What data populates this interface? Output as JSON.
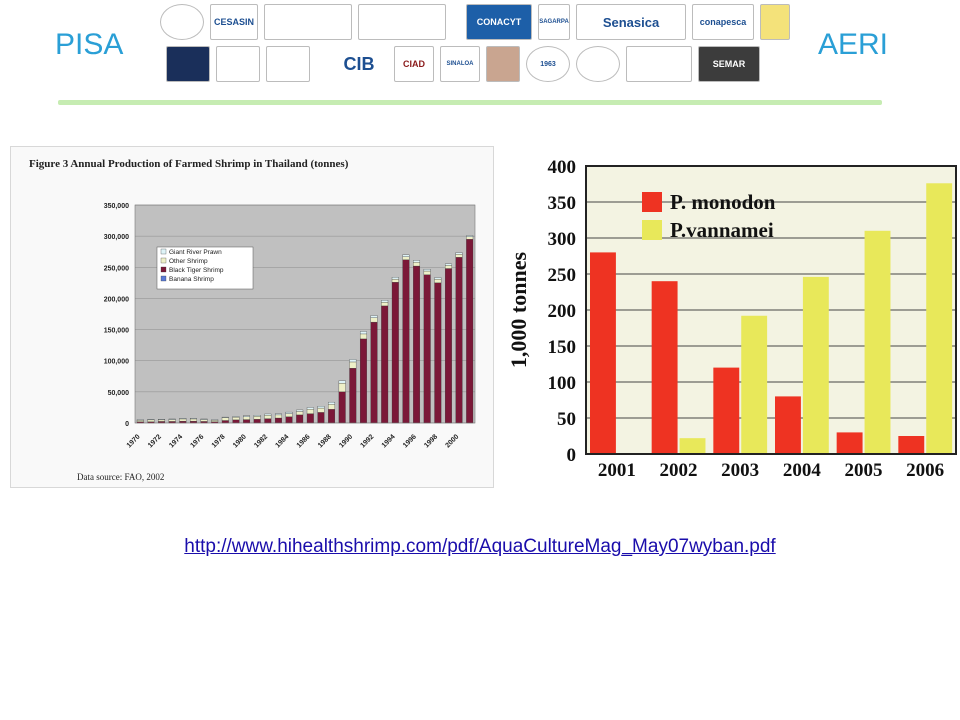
{
  "header": {
    "left_text": "PISA",
    "right_text": "AERI",
    "logos_top": [
      {
        "label": "",
        "icon": "bird-emblem-icon"
      },
      {
        "label": "CESASIN",
        "icon": "fish-emblem-icon"
      },
      {
        "label": "",
        "icon": "wave-emblem-icon"
      },
      {
        "label": "",
        "icon": "crest-emblem-icon"
      },
      {
        "label": "CONACYT",
        "icon": "conacyt-logo-icon"
      },
      {
        "label": "SAGARPA",
        "icon": "eagle-seal-icon"
      },
      {
        "label": "Senasica",
        "icon": "senasica-logo-icon"
      },
      {
        "label": "conapesca",
        "icon": "conapesca-logo-icon"
      },
      {
        "label": "",
        "icon": "state-crest-icon"
      }
    ],
    "logos_bottom": [
      {
        "label": "",
        "icon": "university-seal-icon"
      },
      {
        "label": "",
        "icon": "state-shield-icon"
      },
      {
        "label": "",
        "icon": "coat-of-arms-icon"
      },
      {
        "label": "CIB",
        "icon": "cib-logo-icon"
      },
      {
        "label": "CIAD",
        "icon": "ciad-logo-icon"
      },
      {
        "label": "SINALOA",
        "icon": "sinaloa-logo-icon"
      },
      {
        "label": "",
        "icon": "aztec-emblem-icon"
      },
      {
        "label": "1963",
        "icon": "round-seal-icon"
      },
      {
        "label": "",
        "icon": "round-crest-icon"
      },
      {
        "label": "",
        "icon": "shrimp-emblem-icon"
      },
      {
        "label": "SEMAR",
        "icon": "semar-logo-icon"
      }
    ]
  },
  "link": {
    "url": "http://www.hihealthshrimp.com/pdf/AquaCultureMag_May07wyban.pdf"
  },
  "chart_data": [
    {
      "type": "bar",
      "stacked": true,
      "title": "Figure 3   Annual Production of Farmed Shrimp in Thailand (tonnes)",
      "source": "Data source: FAO, 2002",
      "x": [
        1970,
        1971,
        1972,
        1973,
        1974,
        1975,
        1976,
        1977,
        1978,
        1979,
        1980,
        1981,
        1982,
        1983,
        1984,
        1985,
        1986,
        1987,
        1988,
        1989,
        1990,
        1991,
        1992,
        1993,
        1994,
        1995,
        1996,
        1997,
        1998,
        1999,
        2000,
        2001
      ],
      "x_tick_labels": [
        "1970",
        "1972",
        "1974",
        "1976",
        "1978",
        "1980",
        "1982",
        "1984",
        "1986",
        "1988",
        "1990",
        "1992",
        "1994",
        "1996",
        "1998",
        "2000"
      ],
      "ylim": [
        0,
        350000
      ],
      "y_ticks": [
        "0",
        "50,000",
        "100,000",
        "150,000",
        "200,000",
        "250,000",
        "300,000",
        "350,000"
      ],
      "grid": true,
      "legend_position": "upper-left",
      "colors": {
        "plot_bg": "#c0c0c0",
        "panel_bg": "#f9f9f9"
      },
      "series": [
        {
          "name": "Banana Shrimp",
          "color": "#5b7bd6",
          "values": [
            0,
            0,
            0,
            0,
            0,
            0,
            0,
            0,
            0,
            0,
            0,
            0,
            0,
            0,
            0,
            0,
            0,
            0,
            0,
            0,
            0,
            0,
            0,
            0,
            0,
            0,
            0,
            0,
            0,
            0,
            0,
            0
          ]
        },
        {
          "name": "Black Tiger Shrimp",
          "color": "#7b1838",
          "values": [
            2000,
            2000,
            2500,
            2500,
            3000,
            3000,
            2500,
            2000,
            4000,
            5000,
            5500,
            6000,
            7000,
            8000,
            10000,
            13000,
            15000,
            17000,
            22000,
            50000,
            88000,
            135000,
            162000,
            188000,
            226000,
            262000,
            252000,
            238000,
            225000,
            248000,
            266000,
            295000
          ]
        },
        {
          "name": "Other Shrimp",
          "color": "#eef0c8",
          "values": [
            2500,
            3000,
            2500,
            3000,
            3500,
            3500,
            3000,
            2500,
            4500,
            4500,
            4500,
            5000,
            5500,
            5000,
            5000,
            5500,
            7000,
            7000,
            8000,
            14000,
            10000,
            8000,
            7000,
            6000,
            5000,
            5000,
            6000,
            6000,
            6000,
            5000,
            5000,
            4000
          ]
        },
        {
          "name": "Giant River Prawn",
          "color": "#dff4f8",
          "values": [
            1000,
            1000,
            1000,
            1000,
            1000,
            1000,
            1000,
            1000,
            1000,
            1000,
            1500,
            1500,
            2000,
            2000,
            2500,
            2500,
            3000,
            3000,
            3500,
            4000,
            4000,
            4000,
            3500,
            3000,
            3000,
            3000,
            3000,
            3000,
            2500,
            2500,
            2500,
            2000
          ]
        }
      ]
    },
    {
      "type": "bar",
      "categories": [
        "2001",
        "2002",
        "2003",
        "2004",
        "2005",
        "2006"
      ],
      "ylabel": "1,000 tonnes",
      "ylim": [
        0,
        400
      ],
      "y_ticks": [
        "0",
        "50",
        "100",
        "150",
        "200",
        "250",
        "300",
        "350",
        "400"
      ],
      "grid": true,
      "legend_position": "top-left",
      "colors": {
        "plot_bg": "#f3f3e2"
      },
      "series": [
        {
          "name": "P. monodon",
          "color": "#ee3322",
          "values": [
            280,
            240,
            120,
            80,
            30,
            25
          ]
        },
        {
          "name": "P.vannamei",
          "color": "#e8e85a",
          "values": [
            0,
            22,
            192,
            246,
            310,
            376
          ]
        }
      ]
    }
  ]
}
